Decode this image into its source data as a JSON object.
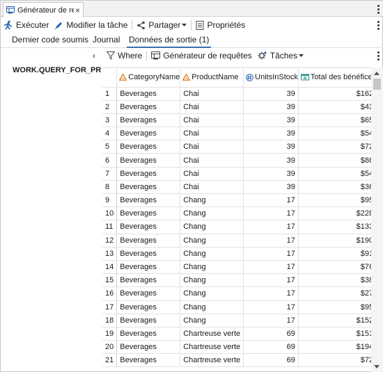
{
  "window": {
    "tab_title": "Générateur de re...",
    "close_glyph": "×"
  },
  "toolbar": {
    "run_label": "Exécuter",
    "edit_label": "Modifier la tâche",
    "share_label": "Partager",
    "properties_label": "Propriétés"
  },
  "subtabs": {
    "code_label": "Dernier code soumis",
    "log_label": "Journal",
    "output_label": "Données de sortie (1)"
  },
  "left_pane": {
    "collapse_glyph": "‹",
    "dataset_name": "WORK.QUERY_FOR_PRO"
  },
  "data_toolbar": {
    "where_label": "Where",
    "query_builder_label": "Générateur de requêtes",
    "tasks_label": "Tâches"
  },
  "colors": {
    "accent_blue": "#1f5fae",
    "char_icon_orange": "#e07b1a",
    "active_tab_underline": "#3a6fb0"
  },
  "table": {
    "columns": [
      {
        "label": "CategoryName",
        "icon": "character-column-icon"
      },
      {
        "label": "ProductName",
        "icon": "character-column-icon"
      },
      {
        "label": "UnitsInStock",
        "icon": "numeric-column-icon"
      },
      {
        "label": "Total des bénéfices",
        "icon": "currency-column-icon"
      }
    ],
    "rows": [
      {
        "n": "1",
        "cat": "Beverages",
        "prod": "Chai",
        "units": "39",
        "total": "$162"
      },
      {
        "n": "2",
        "cat": "Beverages",
        "prod": "Chai",
        "units": "39",
        "total": "$43"
      },
      {
        "n": "3",
        "cat": "Beverages",
        "prod": "Chai",
        "units": "39",
        "total": "$65"
      },
      {
        "n": "4",
        "cat": "Beverages",
        "prod": "Chai",
        "units": "39",
        "total": "$54"
      },
      {
        "n": "5",
        "cat": "Beverages",
        "prod": "Chai",
        "units": "39",
        "total": "$72"
      },
      {
        "n": "6",
        "cat": "Beverages",
        "prod": "Chai",
        "units": "39",
        "total": "$86"
      },
      {
        "n": "7",
        "cat": "Beverages",
        "prod": "Chai",
        "units": "39",
        "total": "$54"
      },
      {
        "n": "8",
        "cat": "Beverages",
        "prod": "Chai",
        "units": "39",
        "total": "$36"
      },
      {
        "n": "9",
        "cat": "Beverages",
        "prod": "Chang",
        "units": "17",
        "total": "$95"
      },
      {
        "n": "10",
        "cat": "Beverages",
        "prod": "Chang",
        "units": "17",
        "total": "$228"
      },
      {
        "n": "11",
        "cat": "Beverages",
        "prod": "Chang",
        "units": "17",
        "total": "$133"
      },
      {
        "n": "12",
        "cat": "Beverages",
        "prod": "Chang",
        "units": "17",
        "total": "$190"
      },
      {
        "n": "13",
        "cat": "Beverages",
        "prod": "Chang",
        "units": "17",
        "total": "$91"
      },
      {
        "n": "14",
        "cat": "Beverages",
        "prod": "Chang",
        "units": "17",
        "total": "$76"
      },
      {
        "n": "15",
        "cat": "Beverages",
        "prod": "Chang",
        "units": "17",
        "total": "$38"
      },
      {
        "n": "16",
        "cat": "Beverages",
        "prod": "Chang",
        "units": "17",
        "total": "$27"
      },
      {
        "n": "17",
        "cat": "Beverages",
        "prod": "Chang",
        "units": "17",
        "total": "$95"
      },
      {
        "n": "18",
        "cat": "Beverages",
        "prod": "Chang",
        "units": "17",
        "total": "$152"
      },
      {
        "n": "19",
        "cat": "Beverages",
        "prod": "Chartreuse verte",
        "units": "69",
        "total": "$151"
      },
      {
        "n": "20",
        "cat": "Beverages",
        "prod": "Chartreuse verte",
        "units": "69",
        "total": "$194"
      },
      {
        "n": "21",
        "cat": "Beverages",
        "prod": "Chartreuse verte",
        "units": "69",
        "total": "$72"
      }
    ]
  }
}
